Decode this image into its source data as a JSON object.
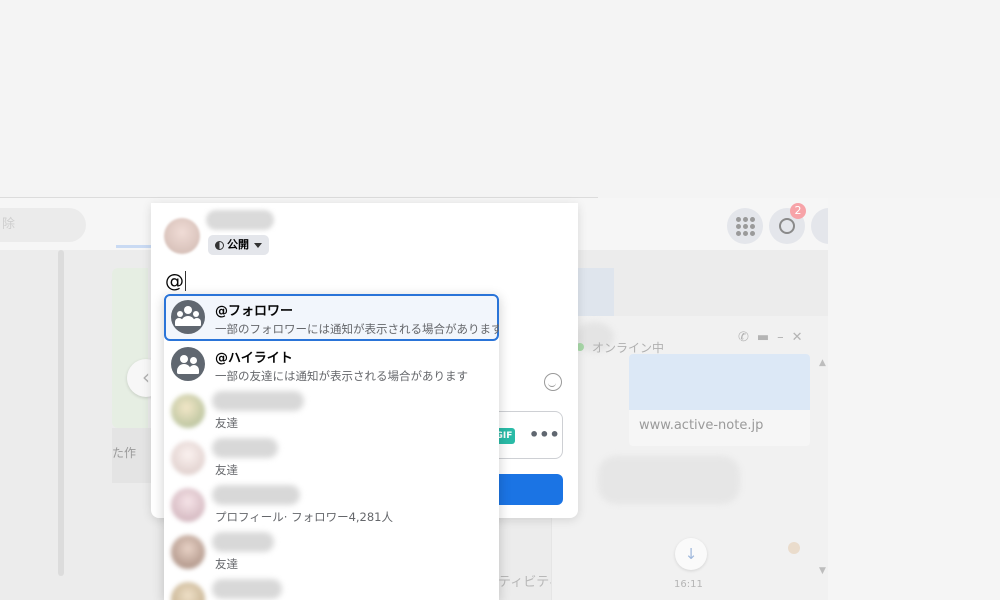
{
  "background": {
    "search_placeholder": "除",
    "story_label": "た作",
    "activity_text": "ティビティ",
    "messenger_badge": "2"
  },
  "chat": {
    "status": "オンライン中",
    "link_url": "www.active-note.jp",
    "time": "16:11"
  },
  "composer": {
    "audience_label": "公開",
    "input_value": "@",
    "gif_label": "GIF",
    "more_label": "•••"
  },
  "mentions": [
    {
      "title": "@フォロワー",
      "subtitle": "一部のフォロワーには通知が表示される場合があります",
      "avatar_icon": "followers-group-icon"
    },
    {
      "title": "@ハイライト",
      "subtitle": "一部の友達には通知が表示される場合があります",
      "avatar_icon": "friends-group-icon"
    },
    {
      "subtitle": "友達"
    },
    {
      "subtitle": "友達"
    },
    {
      "subtitle": "プロフィール· フォロワー4,281人"
    },
    {
      "subtitle": "友達"
    }
  ],
  "colors": {
    "accent": "#1b74e4",
    "selected_border": "#2a74d8",
    "gif": "#2abba7"
  }
}
